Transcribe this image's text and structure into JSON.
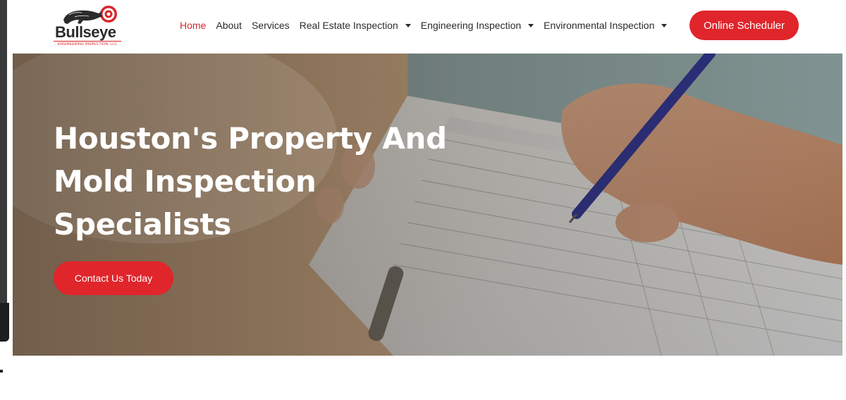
{
  "logo": {
    "name": "Bullseye",
    "tagline": "ENGINEERING INSPECTION, LLC"
  },
  "nav": {
    "items": [
      {
        "label": "Home",
        "active": true,
        "dropdown": false
      },
      {
        "label": "About",
        "active": false,
        "dropdown": false
      },
      {
        "label": "Services",
        "active": false,
        "dropdown": false
      },
      {
        "label": "Real Estate Inspection",
        "active": false,
        "dropdown": true
      },
      {
        "label": "Engineering Inspection",
        "active": false,
        "dropdown": true
      },
      {
        "label": "Environmental Inspection",
        "active": false,
        "dropdown": true
      }
    ]
  },
  "header": {
    "cta_label": "Online Scheduler"
  },
  "hero": {
    "title_lines": [
      "Houston's Property And",
      "Mold Inspection",
      "Specialists"
    ],
    "cta_label": "Contact Us Today"
  },
  "colors": {
    "accent": "#e0252b",
    "nav_text": "#2b2b2b",
    "active_nav": "#d8262c"
  }
}
